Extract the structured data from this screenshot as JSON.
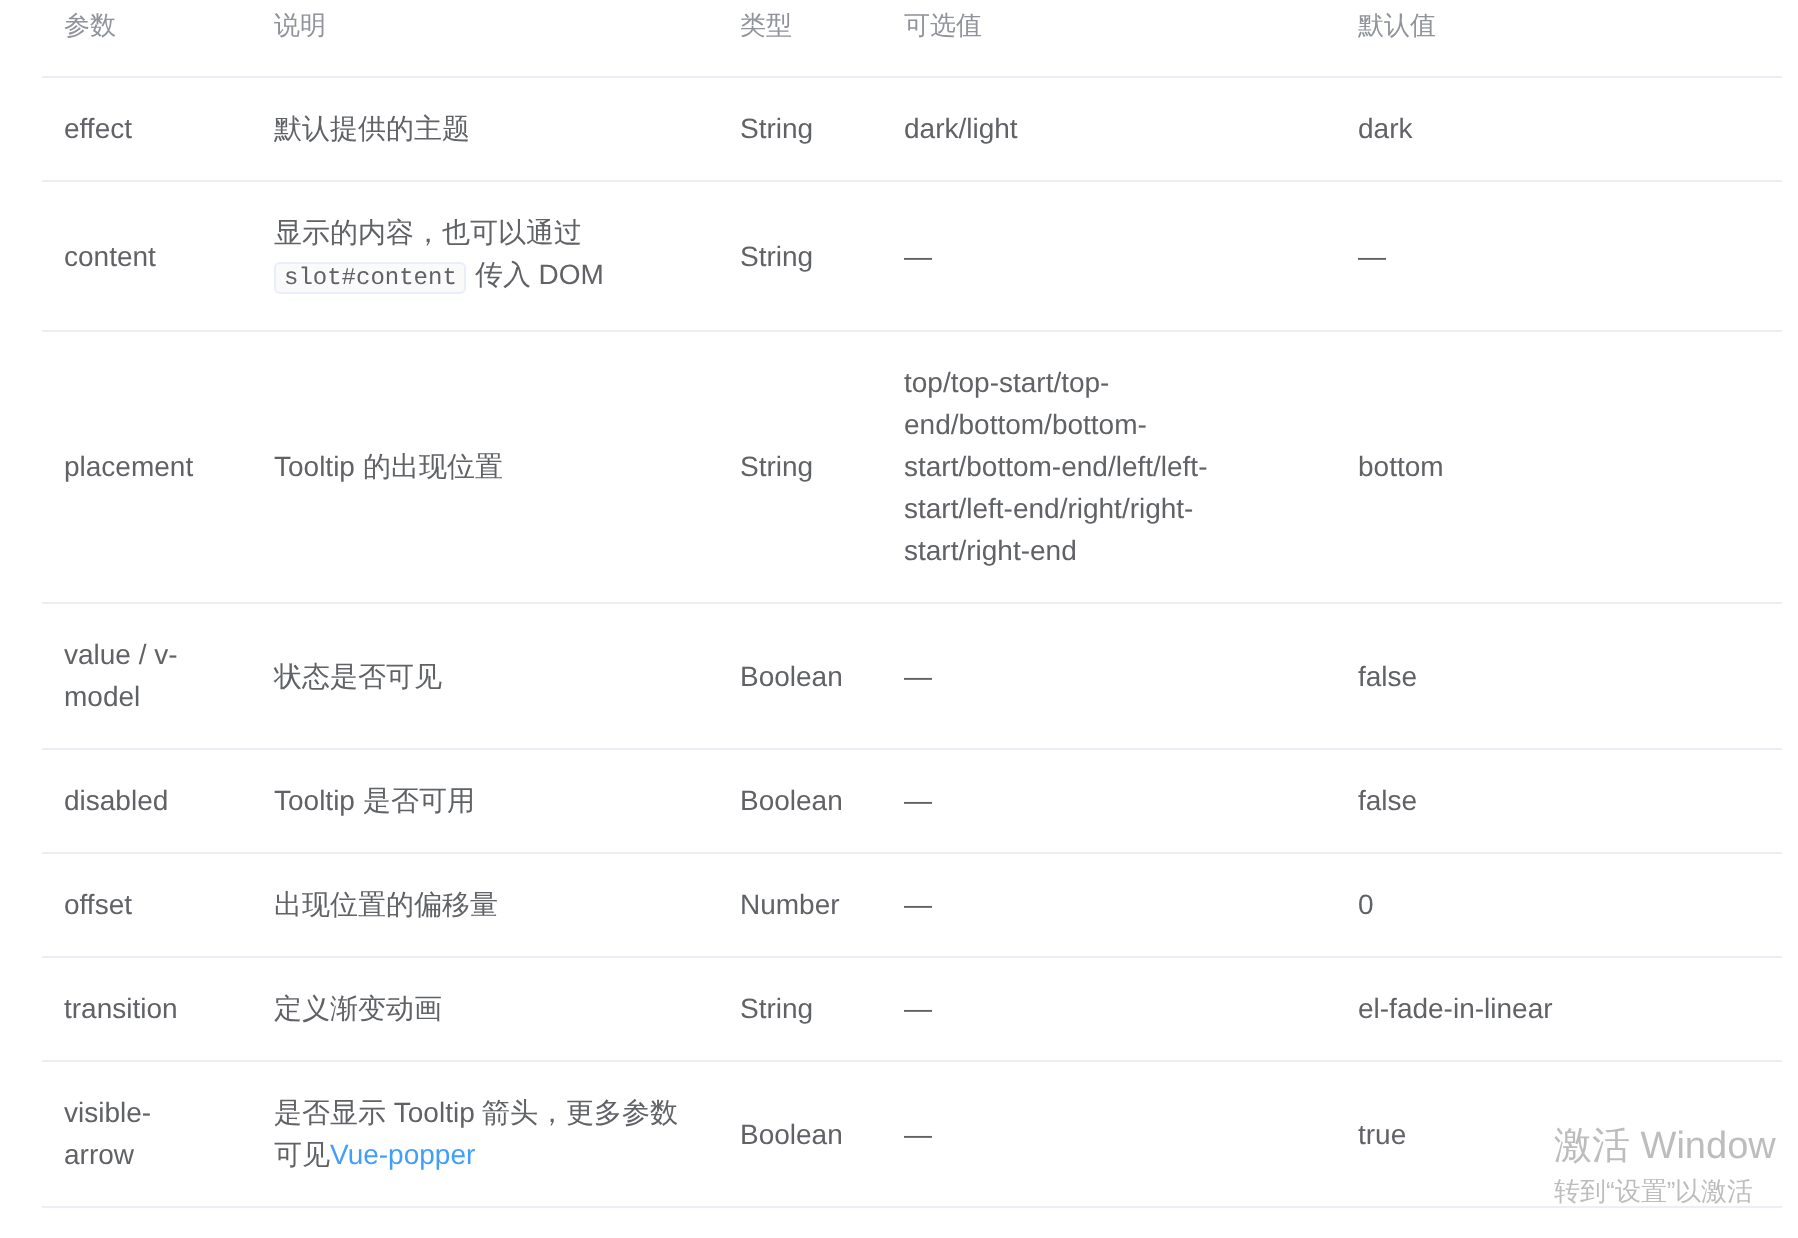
{
  "table": {
    "columns": [
      "参数",
      "说明",
      "类型",
      "可选值",
      "默认值"
    ],
    "rows": [
      {
        "param": "effect",
        "description": [
          {
            "kind": "text",
            "text": "默认提供的主题"
          }
        ],
        "type": "String",
        "options": "dark/light",
        "default": "dark"
      },
      {
        "param": "content",
        "description": [
          {
            "kind": "text",
            "text": "显示的内容，也可以通过"
          },
          {
            "kind": "code",
            "text": "slot#content"
          },
          {
            "kind": "text",
            "text": "传入 DOM"
          }
        ],
        "type": "String",
        "options": "—",
        "default": "—"
      },
      {
        "param": "placement",
        "description": [
          {
            "kind": "text",
            "text": "Tooltip 的出现位置"
          }
        ],
        "type": "String",
        "options": "top/top-start/top-end/bottom/bottom-start/bottom-end/left/left-start/left-end/right/right-start/right-end",
        "default": "bottom"
      },
      {
        "param": "value / v-model",
        "description": [
          {
            "kind": "text",
            "text": "状态是否可见"
          }
        ],
        "type": "Boolean",
        "options": "—",
        "default": "false"
      },
      {
        "param": "disabled",
        "description": [
          {
            "kind": "text",
            "text": "Tooltip 是否可用"
          }
        ],
        "type": "Boolean",
        "options": "—",
        "default": "false"
      },
      {
        "param": "offset",
        "description": [
          {
            "kind": "text",
            "text": "出现位置的偏移量"
          }
        ],
        "type": "Number",
        "options": "—",
        "default": "0"
      },
      {
        "param": "transition",
        "description": [
          {
            "kind": "text",
            "text": "定义渐变动画"
          }
        ],
        "type": "String",
        "options": "—",
        "default": "el-fade-in-linear"
      },
      {
        "param": "visible-arrow",
        "description": [
          {
            "kind": "text",
            "text": "是否显示 Tooltip 箭头，更多参数可见"
          },
          {
            "kind": "link",
            "text": "Vue-popper"
          }
        ],
        "type": "Boolean",
        "options": "—",
        "default": "true"
      }
    ]
  },
  "activation_notice": {
    "title": "激活 Window",
    "subtitle": "转到“设置”以激活"
  }
}
